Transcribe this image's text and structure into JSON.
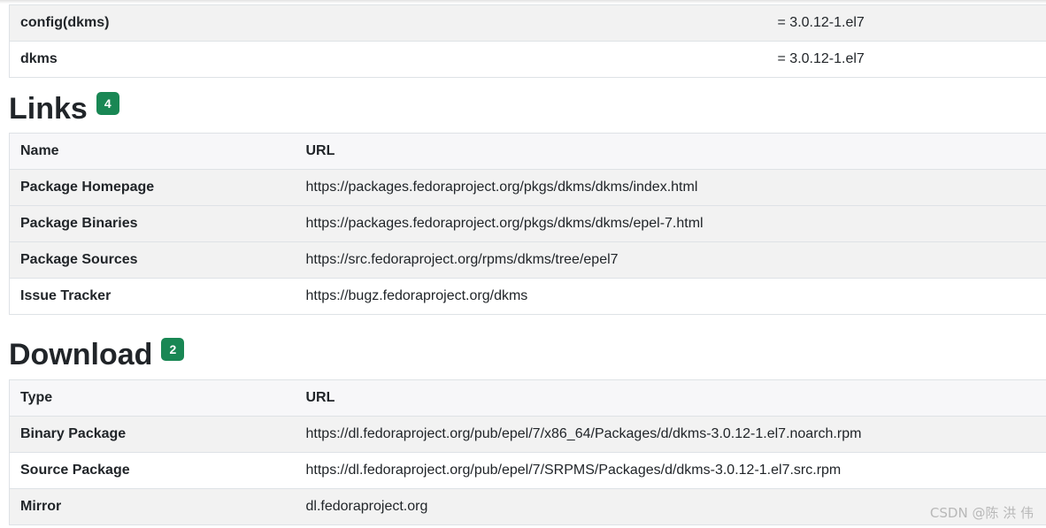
{
  "provides": {
    "rows": [
      {
        "name": "config(dkms)",
        "version": "= 3.0.12-1.el7"
      },
      {
        "name": "dkms",
        "version": "= 3.0.12-1.el7"
      }
    ]
  },
  "links": {
    "title": "Links",
    "count": "4",
    "headers": {
      "name": "Name",
      "url": "URL"
    },
    "rows": [
      {
        "name": "Package Homepage",
        "url": "https://packages.fedoraproject.org/pkgs/dkms/dkms/index.html"
      },
      {
        "name": "Package Binaries",
        "url": "https://packages.fedoraproject.org/pkgs/dkms/dkms/epel-7.html"
      },
      {
        "name": "Package Sources",
        "url": "https://src.fedoraproject.org/rpms/dkms/tree/epel7"
      },
      {
        "name": "Issue Tracker",
        "url": "https://bugz.fedoraproject.org/dkms"
      }
    ]
  },
  "download": {
    "title": "Download",
    "count": "2",
    "headers": {
      "type": "Type",
      "url": "URL"
    },
    "rows": [
      {
        "type": "Binary Package",
        "url": "https://dl.fedoraproject.org/pub/epel/7/x86_64/Packages/d/dkms-3.0.12-1.el7.noarch.rpm"
      },
      {
        "type": "Source Package",
        "url": "https://dl.fedoraproject.org/pub/epel/7/SRPMS/Packages/d/dkms-3.0.12-1.el7.src.rpm"
      },
      {
        "type": "Mirror",
        "url": "dl.fedoraproject.org"
      }
    ]
  },
  "watermark": "CSDN @陈 洪 伟",
  "colors": {
    "badge": "#198754",
    "border": "#dee2e6",
    "stripe": "#f2f2f2"
  }
}
